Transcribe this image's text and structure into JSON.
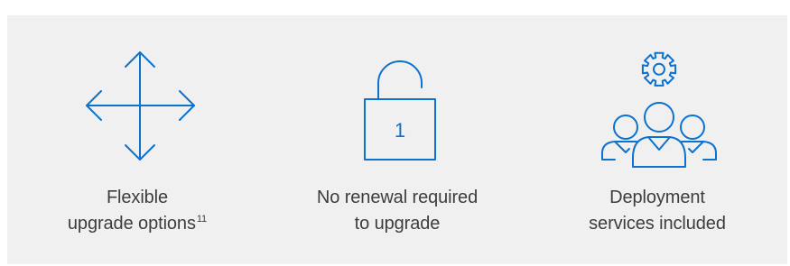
{
  "colors": {
    "panel_background": "#f0f0f0",
    "icon_stroke": "#0b72cf",
    "text": "#3d3d3d"
  },
  "features": [
    {
      "icon": "four-way-arrows-icon",
      "line1": "Flexible",
      "line2": "upgrade options",
      "footnote": "11"
    },
    {
      "icon": "unlocked-padlock-icon",
      "lock_label": "1",
      "line1": "No renewal required",
      "line2": "to upgrade"
    },
    {
      "icon": "team-with-gear-icon",
      "line1": "Deployment",
      "line2": "services included"
    }
  ]
}
